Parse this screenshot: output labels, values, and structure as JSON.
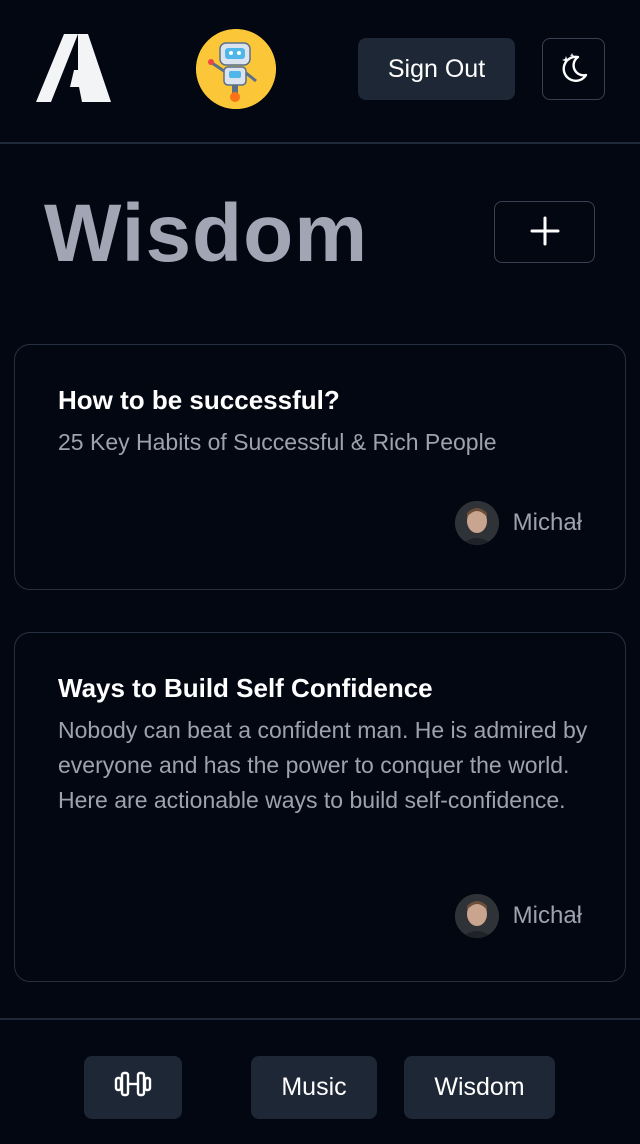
{
  "header": {
    "sign_out_label": "Sign Out",
    "logo_icon": "app-logo",
    "avatar_icon": "robot-avatar",
    "theme_icon": "moon-stars-icon"
  },
  "main": {
    "title": "Wisdom",
    "add_icon": "plus-icon",
    "cards": [
      {
        "title": "How to be successful?",
        "description": "25 Key Habits of Successful & Rich People",
        "author": "Michał"
      },
      {
        "title": "Ways to Build Self Confidence",
        "description": "Nobody can beat a confident man. He is admired by everyone and has the power to conquer the world. Here are actionable ways to build self-confidence.",
        "author": "Michał"
      }
    ]
  },
  "footer": {
    "fitness_icon": "dumbbell-icon",
    "music_label": "Music",
    "wisdom_label": "Wisdom"
  },
  "colors": {
    "background": "#030712",
    "button_bg": "#1e2735",
    "border": "#1f2937",
    "muted_text": "#9ca3af",
    "title_text": "#a0a6b4",
    "avatar_yellow": "#fbc638"
  }
}
